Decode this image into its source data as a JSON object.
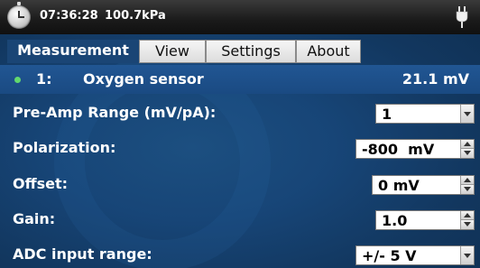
{
  "statusbar": {
    "time": "07:36:28",
    "pressure": "100.7kPa",
    "left_icon": "stopwatch-icon",
    "right_icon": "power-plug-icon"
  },
  "tabs": [
    {
      "label": "Measurement",
      "active": true
    },
    {
      "label": "View",
      "active": false
    },
    {
      "label": "Settings",
      "active": false
    },
    {
      "label": "About",
      "active": false
    }
  ],
  "sensor": {
    "status_color": "#62d86e",
    "number": "1:",
    "name": "Oxygen sensor",
    "value": "21.1 mV"
  },
  "settings": {
    "preamp": {
      "label": "Pre-Amp Range (mV/pA):",
      "value": "1"
    },
    "polarization": {
      "label": "Polarization:",
      "value": "-800  mV"
    },
    "offset": {
      "label": "Offset:",
      "value": "0 mV"
    },
    "gain": {
      "label": "Gain:",
      "value": "1.0"
    },
    "adc": {
      "label": "ADC input range:",
      "value": "+/- 5 V"
    }
  }
}
